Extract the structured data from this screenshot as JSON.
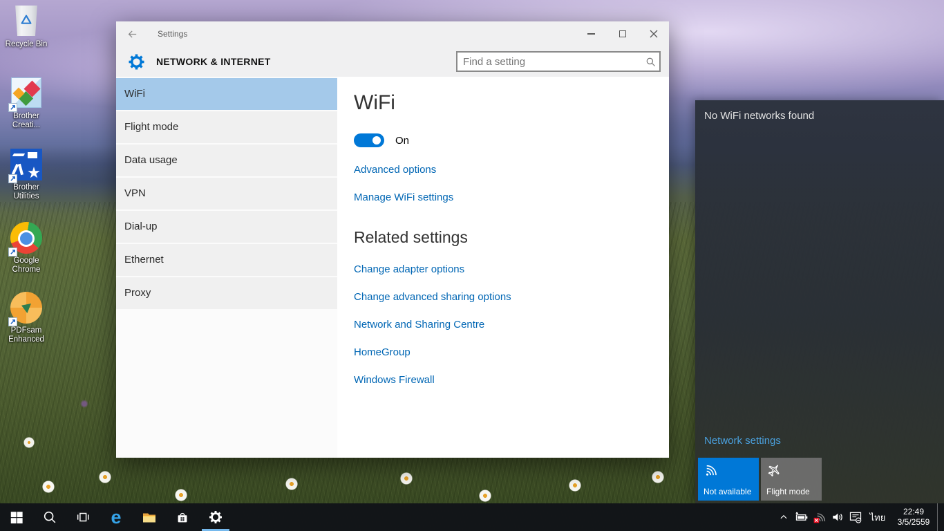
{
  "desktop": {
    "icons": [
      {
        "name": "recycle-bin",
        "lines": [
          "Recycle Bin",
          ""
        ]
      },
      {
        "name": "brother-creative-center",
        "lines": [
          "Brother",
          "Creati..."
        ]
      },
      {
        "name": "brother-utilities",
        "lines": [
          "Brother",
          "Utilities"
        ]
      },
      {
        "name": "google-chrome",
        "lines": [
          "Google",
          "Chrome"
        ]
      },
      {
        "name": "pdfsam-enhanced",
        "lines": [
          "PDFsam",
          "Enhanced"
        ]
      }
    ]
  },
  "window": {
    "title": "Settings",
    "header": {
      "title": "NETWORK & INTERNET",
      "search_placeholder": "Find a setting"
    },
    "sidebar": {
      "items": [
        {
          "label": "WiFi",
          "selected": true
        },
        {
          "label": "Flight mode",
          "selected": false
        },
        {
          "label": "Data usage",
          "selected": false
        },
        {
          "label": "VPN",
          "selected": false
        },
        {
          "label": "Dial-up",
          "selected": false
        },
        {
          "label": "Ethernet",
          "selected": false
        },
        {
          "label": "Proxy",
          "selected": false
        }
      ]
    },
    "content": {
      "heading": "WiFi",
      "toggle_state": "On",
      "links": [
        "Advanced options",
        "Manage WiFi settings"
      ],
      "related_heading": "Related settings",
      "related_links": [
        "Change adapter options",
        "Change advanced sharing options",
        "Network and Sharing Centre",
        "HomeGroup",
        "Windows Firewall"
      ]
    }
  },
  "flyout": {
    "message": "No WiFi networks found",
    "network_settings_label": "Network settings",
    "tiles": [
      {
        "label": "Not available",
        "icon": "wifi-icon",
        "selected": true
      },
      {
        "label": "Flight mode",
        "icon": "airplane-icon",
        "selected": false
      }
    ]
  },
  "taskbar": {
    "language": "ไทย",
    "clock_time": "22:49",
    "clock_date": "3/5/2559",
    "icons": [
      "start",
      "search",
      "task-view",
      "edge",
      "file-explorer",
      "store",
      "settings-gear"
    ],
    "tray_icons": [
      "chevron-up",
      "battery-charging",
      "network-unavailable",
      "speaker",
      "action-center"
    ]
  },
  "colors": {
    "accent": "#0078d7",
    "sidebar_selected": "#a4c9ea",
    "window_link": "#0066b4",
    "flyout_link": "#4aa0dd",
    "tile_gray": "#767676",
    "taskbar_underline": "#76b9ed"
  }
}
